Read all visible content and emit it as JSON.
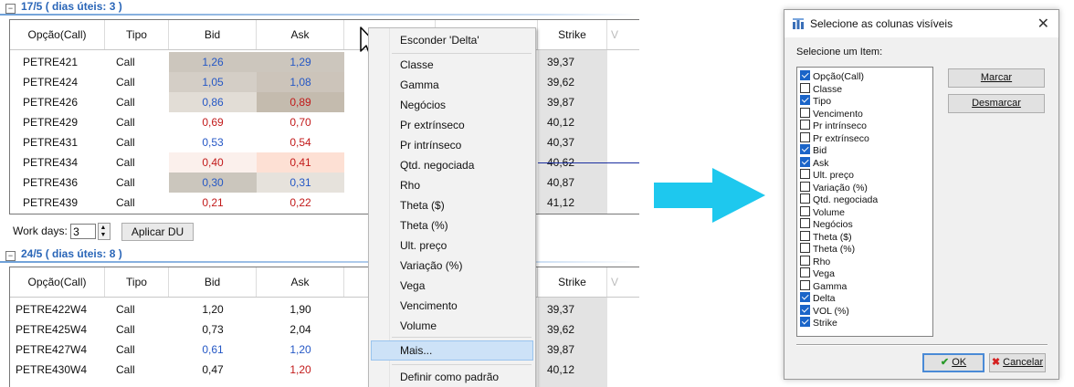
{
  "group1": {
    "header": "17/5 ( dias úteis: 3 )",
    "toggle": "−",
    "columns": [
      "Opção(Call)",
      "Tipo",
      "Bid",
      "Ask",
      "",
      "",
      "Strike",
      "V"
    ],
    "rows": [
      {
        "opcao": "PETRE421",
        "tipo": "Call",
        "bid": "1,26",
        "ask": "1,29",
        "strike": "39,37"
      },
      {
        "opcao": "PETRE424",
        "tipo": "Call",
        "bid": "1,05",
        "ask": "1,08",
        "strike": "39,62"
      },
      {
        "opcao": "PETRE426",
        "tipo": "Call",
        "bid": "0,86",
        "ask": "0,89",
        "strike": "39,87"
      },
      {
        "opcao": "PETRE429",
        "tipo": "Call",
        "bid": "0,69",
        "ask": "0,70",
        "strike": "40,12"
      },
      {
        "opcao": "PETRE431",
        "tipo": "Call",
        "bid": "0,53",
        "ask": "0,54",
        "strike": "40,37"
      },
      {
        "opcao": "PETRE434",
        "tipo": "Call",
        "bid": "0,40",
        "ask": "0,41",
        "strike": "40,62"
      },
      {
        "opcao": "PETRE436",
        "tipo": "Call",
        "bid": "0,30",
        "ask": "0,31",
        "strike": "40,87"
      },
      {
        "opcao": "PETRE439",
        "tipo": "Call",
        "bid": "0,21",
        "ask": "0,22",
        "strike": "41,12"
      }
    ],
    "work_days_label": "Work days:",
    "work_days_value": "3",
    "apply_button": "Aplicar DU"
  },
  "group2": {
    "header": "24/5 ( dias úteis: 8 )",
    "toggle": "−",
    "columns": [
      "Opção(Call)",
      "Tipo",
      "Bid",
      "Ask",
      "",
      "",
      "Strike",
      "V"
    ],
    "rows": [
      {
        "opcao": "PETRE422W4",
        "tipo": "Call",
        "bid": "1,20",
        "ask": "1,90",
        "strike": "39,37"
      },
      {
        "opcao": "PETRE425W4",
        "tipo": "Call",
        "bid": "0,73",
        "ask": "2,04",
        "strike": "39,62"
      },
      {
        "opcao": "PETRE427W4",
        "tipo": "Call",
        "bid": "0,61",
        "ask": "1,20",
        "strike": "39,87"
      },
      {
        "opcao": "PETRE430W4",
        "tipo": "Call",
        "bid": "0,47",
        "ask": "1,20",
        "strike": "40,12"
      }
    ]
  },
  "context_menu": {
    "hide_item": "Esconder 'Delta'",
    "items": [
      "Classe",
      "Gamma",
      "Negócios",
      "Pr extrínseco",
      "Pr intrínseco",
      "Qtd. negociada",
      "Rho",
      "Theta ($)",
      "Theta (%)",
      "Ult. preço",
      "Variação (%)",
      "Vega",
      "Vencimento",
      "Volume"
    ],
    "more_item": "Mais...",
    "default_item": "Definir como padrão"
  },
  "dialog": {
    "title": "Selecione as colunas visíveis",
    "close": "✕",
    "subtitle": "Selecione um Item:",
    "items": [
      {
        "label": "Opção(Call)",
        "checked": true
      },
      {
        "label": "Classe",
        "checked": false
      },
      {
        "label": "Tipo",
        "checked": true
      },
      {
        "label": "Vencimento",
        "checked": false
      },
      {
        "label": "Pr intrínseco",
        "checked": false
      },
      {
        "label": "Pr extrínseco",
        "checked": false
      },
      {
        "label": "Bid",
        "checked": true
      },
      {
        "label": "Ask",
        "checked": true
      },
      {
        "label": "Ult. preço",
        "checked": false
      },
      {
        "label": "Variação (%)",
        "checked": false
      },
      {
        "label": "Qtd. negociada",
        "checked": false
      },
      {
        "label": "Volume",
        "checked": false
      },
      {
        "label": "Negócios",
        "checked": false
      },
      {
        "label": "Theta ($)",
        "checked": false
      },
      {
        "label": "Theta (%)",
        "checked": false
      },
      {
        "label": "Rho",
        "checked": false
      },
      {
        "label": "Vega",
        "checked": false
      },
      {
        "label": "Gamma",
        "checked": false
      },
      {
        "label": "Delta",
        "checked": true
      },
      {
        "label": "VOL (%)",
        "checked": true
      },
      {
        "label": "Strike",
        "checked": true
      }
    ],
    "mark_button": "Marcar",
    "unmark_button": "Desmarcar",
    "ok_button": "OK",
    "cancel_button": "Cancelar"
  },
  "colors": {
    "bid_up": "#2457c5",
    "bid_down": "#c21a1a",
    "accent": "#2a66b8",
    "arrow": "#1ec8ee",
    "menu_highlight": "#cde2f7"
  }
}
